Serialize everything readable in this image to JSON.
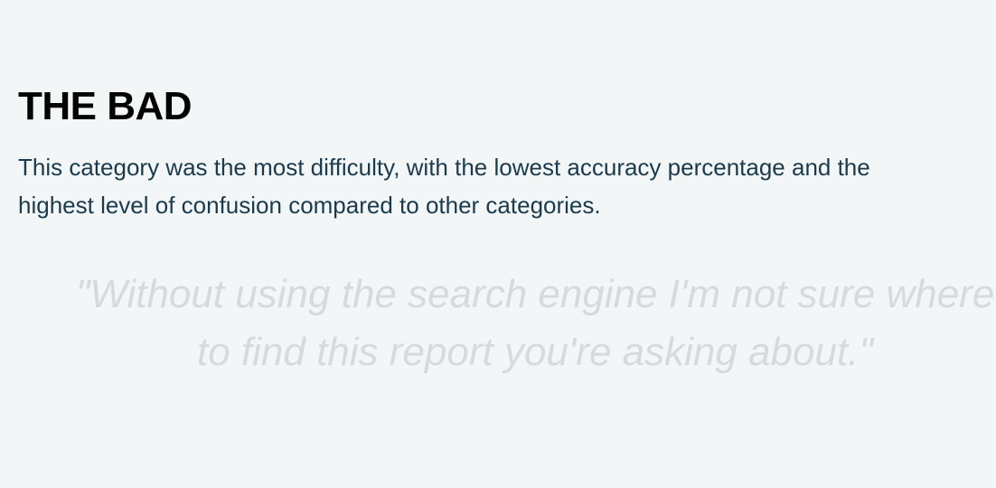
{
  "section": {
    "title": "THE BAD",
    "description_line1": "This category was the most difficulty, with the lowest accuracy percentage and the",
    "description_line2": "highest level of confusion compared to other categories.",
    "quote_line1": "\"Without using the search engine I'm not sure where",
    "quote_line2": "to find this report you're asking about.\""
  },
  "colors": {
    "background": "#f2f6f7",
    "title": "#050505",
    "description": "#1d3a4a",
    "quote": "#d6dadc"
  }
}
